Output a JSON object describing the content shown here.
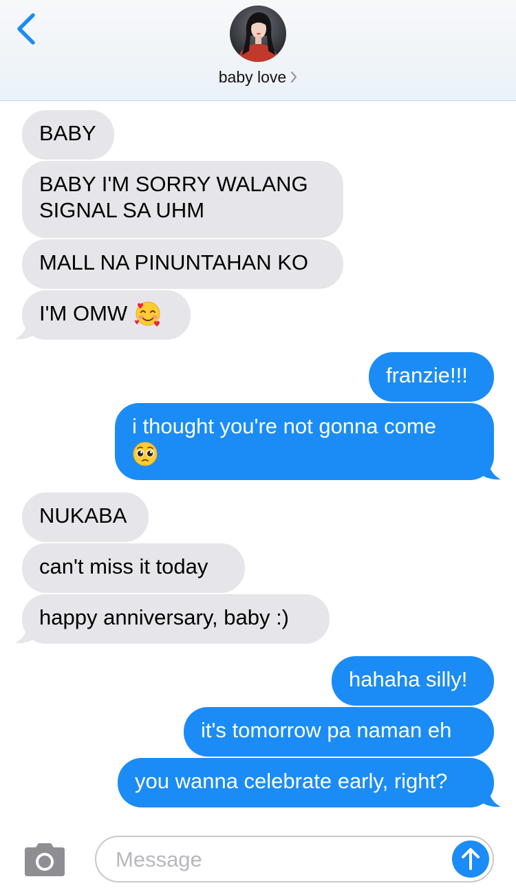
{
  "header": {
    "contact_name": "baby love",
    "back_icon": "chevron-left-icon",
    "detail_icon": "chevron-right-icon"
  },
  "colors": {
    "accent": "#1b8cf5",
    "incoming_bubble": "#e5e5ea",
    "outgoing_bubble": "#1b8cf5"
  },
  "messages": [
    {
      "direction": "incoming",
      "text": "BABY"
    },
    {
      "direction": "incoming",
      "line1": "BABY I'M SORRY WALANG",
      "line2": "SIGNAL SA UHM"
    },
    {
      "direction": "incoming",
      "text": "MALL NA PINUNTAHAN KO"
    },
    {
      "direction": "incoming",
      "text": "I'M OMW",
      "emoji": "smiling-face-with-hearts"
    },
    {
      "direction": "outgoing",
      "text": "franzie!!!"
    },
    {
      "direction": "outgoing",
      "text": "i thought you're not gonna come",
      "emoji": "pleading-face"
    },
    {
      "direction": "incoming",
      "text": "NUKABA"
    },
    {
      "direction": "incoming",
      "text": "can't miss it today"
    },
    {
      "direction": "incoming",
      "text": "happy anniversary, baby :)"
    },
    {
      "direction": "outgoing",
      "text": "hahaha silly!"
    },
    {
      "direction": "outgoing",
      "text": "it's tomorrow pa naman eh"
    },
    {
      "direction": "outgoing",
      "text": "you wanna celebrate early, right?"
    }
  ],
  "composer": {
    "placeholder": "Message",
    "value": "",
    "camera_icon": "camera-icon",
    "send_icon": "send-arrow-up-icon"
  }
}
